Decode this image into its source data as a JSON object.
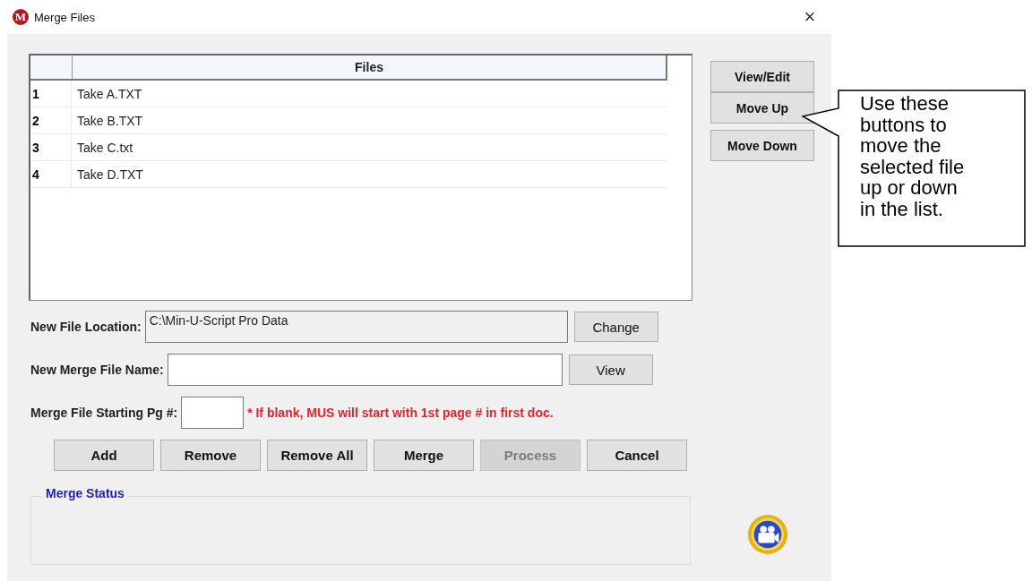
{
  "window": {
    "icon_letter": "M",
    "title": "Merge Files",
    "close": "×"
  },
  "files_table": {
    "columns": [
      "Files"
    ],
    "rows": [
      {
        "number": "1",
        "name": "Take A.TXT"
      },
      {
        "number": "2",
        "name": "Take B.TXT"
      },
      {
        "number": "3",
        "name": "Take C.txt"
      },
      {
        "number": "4",
        "name": "Take D.TXT"
      }
    ]
  },
  "side_buttons": [
    "View/Edit",
    "Move Up",
    "Move Down"
  ],
  "fields": [
    {
      "kind": "wide",
      "label": "New File Location:",
      "value": "C:\\Min-U-Script Pro Data",
      "disabled": true,
      "button": "Change"
    },
    {
      "kind": "wide",
      "label": "New Merge File Name:",
      "disabled": false,
      "button": "View"
    },
    {
      "kind": "short",
      "label": "Merge File Starting Pg #:",
      "disabled": false,
      "note": "* If blank, MUS will start with 1st page # in first doc."
    }
  ],
  "action_buttons": [
    {
      "label": "Add",
      "disabled": false
    },
    {
      "label": "Remove",
      "disabled": false
    },
    {
      "label": "Remove All",
      "disabled": false
    },
    {
      "label": "Merge",
      "disabled": false
    },
    {
      "label": "Process",
      "disabled": true
    },
    {
      "label": "Cancel",
      "disabled": false
    }
  ],
  "status_group": {
    "title": "Merge Status"
  },
  "callout": {
    "text": "Use these buttons to move the selected file up or down in the list."
  }
}
